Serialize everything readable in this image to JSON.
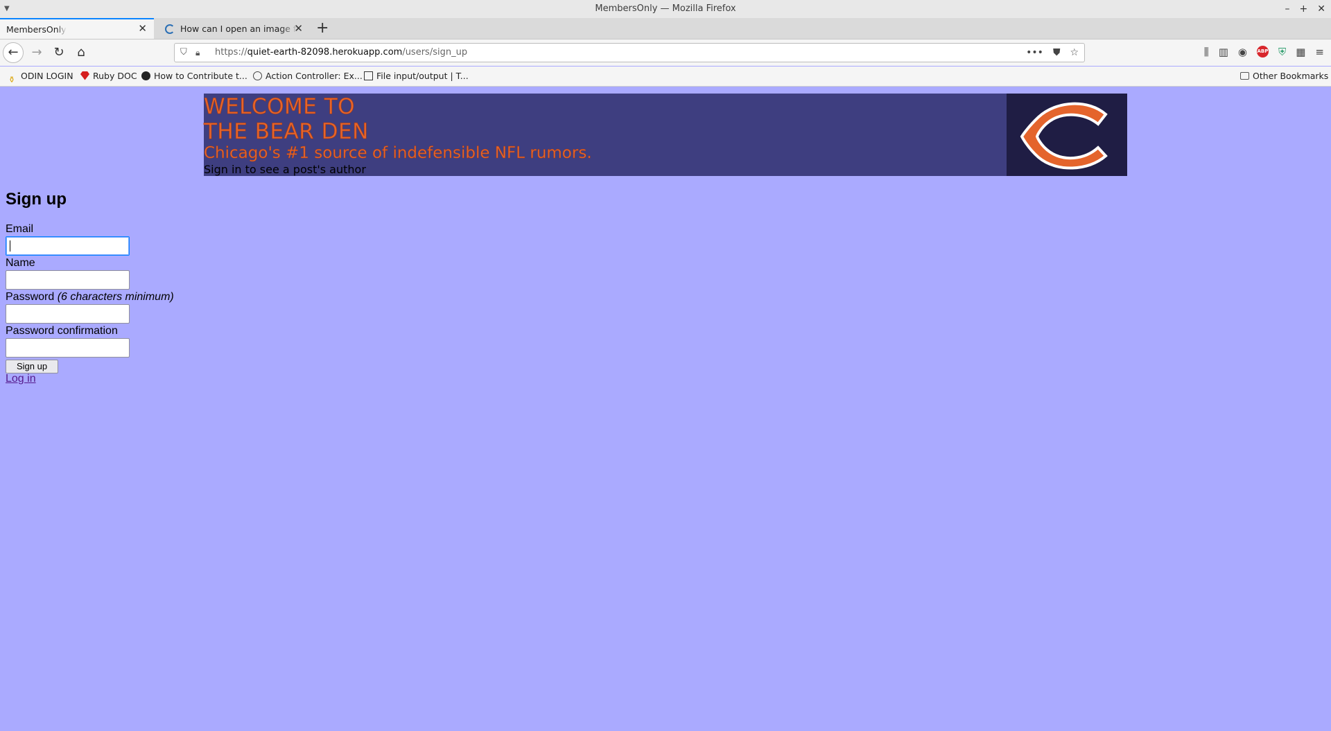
{
  "window": {
    "title": "MembersOnly — Mozilla Firefox"
  },
  "tabs": [
    {
      "label": "MembersOnly"
    },
    {
      "label": "How can I open an image file"
    }
  ],
  "address_bar": {
    "scheme": "https://",
    "host": "quiet-earth-82098.herokuapp.com",
    "path": "/users/sign_up"
  },
  "bookmarks": [
    {
      "label": "ODIN LOGIN",
      "icon": "odin-icon"
    },
    {
      "label": "Ruby DOC",
      "icon": "ruby-icon"
    },
    {
      "label": "How to Contribute t...",
      "icon": "github-icon"
    },
    {
      "label": "Action Controller: Ex...",
      "icon": "globe-icon"
    },
    {
      "label": "File input/output | T...",
      "icon": "page-icon"
    },
    {
      "label": "Other Bookmarks",
      "icon": "folder-icon"
    }
  ],
  "banner": {
    "line1": "WELCOME TO",
    "line2": "THE BEAR DEN",
    "tagline": "Chicago's #1 source of indefensible NFL rumors.",
    "note": "Sign in to see a post's author",
    "logo": "chicago-bears-c-logo",
    "colors": {
      "background": "#3e3e80",
      "text": "#e4642c",
      "logo_bg": "#1f1d44"
    }
  },
  "form": {
    "heading": "Sign up",
    "email_label": "Email",
    "name_label": "Name",
    "password_label": "Password",
    "password_hint": "(6 characters minimum)",
    "password_confirmation_label": "Password confirmation",
    "email_value": "",
    "name_value": "",
    "password_value": "",
    "password_confirmation_value": "",
    "submit_label": "Sign up",
    "login_link": "Log in"
  },
  "page": {
    "background": "#aaaaff"
  }
}
